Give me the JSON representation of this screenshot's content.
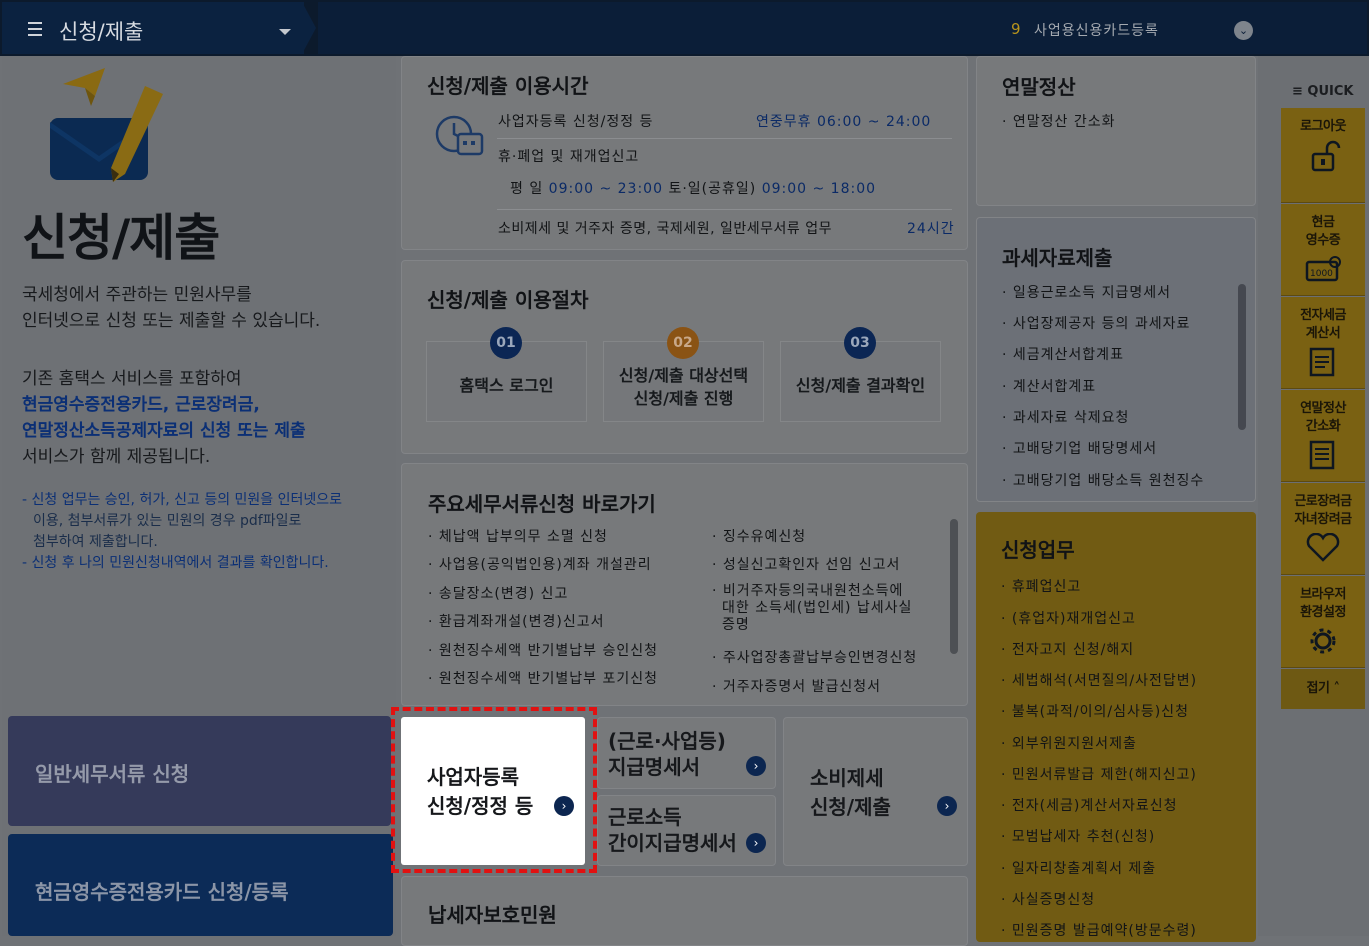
{
  "header": {
    "menu_title": "신청/제출",
    "notice_number": "9",
    "notice_text": "사업용신용카드등록"
  },
  "hero": {
    "title": "신청/제출",
    "desc_line1": "국세청에서 주관하는 민원사무를",
    "desc_line2": "인터넷으로 신청 또는 제출할 수 있습니다.",
    "desc2_line1": "기존 홈택스 서비스를 포함하여",
    "desc2_line2": "현금영수증전용카드, 근로장려금,",
    "desc2_line3": "연말정산소득공제자료의 신청 또는 제출",
    "desc2_line4": "서비스가 함께 제공됩니다.",
    "note1": "- 신청 업무는 승인, 허가, 신고 등의 민원을 인터넷으로",
    "note1b": "이용, 첨부서류가 있는 민원의 경우 pdf파일로",
    "note1c": "첨부하여 제출합니다.",
    "note2": "- 신청 후 나의 민원신청내역에서 결과를 확인합니다."
  },
  "left_buttons": {
    "general": "일반세무서류 신청",
    "cash_card": "현금영수증전용카드 신청/등록"
  },
  "hours": {
    "title": "신청/제출 이용시간",
    "row1_label": "사업자등록 신청/정정 등",
    "row1_time": "연중무휴 06:00 ~ 24:00",
    "row2_label": "휴·폐업 및 재개업신고",
    "row2_weekday_label": "평 일",
    "row2_weekday_time": "09:00 ~ 23:00",
    "row2_sat_label": "토·일(공휴일)",
    "row2_sat_time": "09:00 ~  18:00",
    "row3_label": "소비제세 및 거주자 증명, 국제세원, 일반세무서류 업무",
    "row3_time": "24시간"
  },
  "procedure": {
    "title": "신청/제출 이용절차",
    "steps": [
      {
        "num": "01",
        "label": "홈택스 로그인"
      },
      {
        "num": "02",
        "label1": "신청/제출 대상선택",
        "label2": "신청/제출 진행"
      },
      {
        "num": "03",
        "label": "신청/제출 결과확인"
      }
    ]
  },
  "shortcuts": {
    "title": "주요세무서류신청 바로가기",
    "left_items": [
      "체납액 납부의무 소멸 신청",
      "사업용(공익법인용)계좌 개설관리",
      "송달장소(변경) 신고",
      "환급계좌개설(변경)신고서",
      "원천징수세액 반기별납부 승인신청",
      "원천징수세액 반기별납부 포기신청"
    ],
    "right_items": [
      "징수유예신청",
      "성실신고확인자 선임 신고서",
      "비거주자등의국내원천소득에",
      "대한 소득세(법인세) 납세사실",
      "증명",
      "주사업장총괄납부승인변경신청",
      "거주자증명서 발급신청서"
    ]
  },
  "tiles": {
    "biz_reg_line1": "사업자등록",
    "biz_reg_line2": "신청/정정 등",
    "payment_line1": "(근로·사업등)",
    "payment_line2": "지급명세서",
    "simple_line1": "근로소득",
    "simple_line2": "간이지급명세서",
    "consumption_line1": "소비제세",
    "consumption_line2": "신청/제출",
    "protection": "납세자보호민원"
  },
  "yearend": {
    "title": "연말정산",
    "item": "연말정산 간소화"
  },
  "taxdata": {
    "title": "과세자료제출",
    "items": [
      "일용근로소득 지급명세서",
      "사업장제공자 등의 과세자료",
      "세금계산서합계표",
      "계산서합계표",
      "과세자료 삭제요청",
      "고배당기업 배당명세서",
      "고배당기업 배당소득 원천징수"
    ]
  },
  "apply": {
    "title": "신청업무",
    "items": [
      "휴폐업신고",
      "(휴업자)재개업신고",
      "전자고지 신청/해지",
      "세법해석(서면질의/사전답변)",
      "불복(과적/이의/심사등)신청",
      "외부위원지원서제출",
      "민원서류발급 제한(해지신고)",
      "전자(세금)계산서자료신청",
      "모범납세자 추천(신청)",
      "일자리창출계획서 제출",
      "사실증명신청",
      "민원증명 발급예약(방문수령)"
    ]
  },
  "quick": {
    "header": "QUICK",
    "logout": "로그아웃",
    "cash_receipt": "현금\n영수증",
    "e_invoice": "전자세금\n계산서",
    "yearend": "연말정산\n간소화",
    "incentive": "근로장려금\n자녀장려금",
    "browser": "브라우저\n환경설정",
    "collapse": "접기",
    "badge_1000": "1000"
  }
}
